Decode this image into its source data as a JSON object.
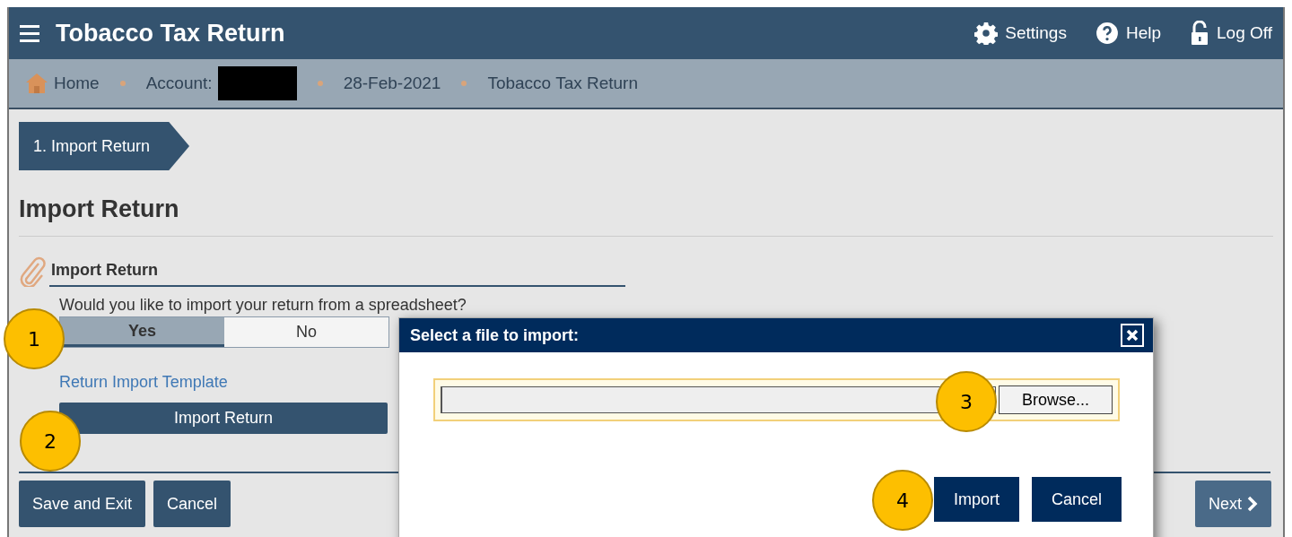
{
  "header": {
    "title": "Tobacco Tax Return",
    "actions": [
      {
        "label": "Settings",
        "kind": "gear"
      },
      {
        "label": "Help",
        "kind": "help"
      },
      {
        "label": "Log Off",
        "kind": "lock"
      }
    ]
  },
  "breadcrumb": [
    {
      "label": "Home",
      "kind": "home"
    },
    {
      "label": "Account:",
      "kind": "redacted"
    },
    {
      "label": "28-Feb-2021",
      "kind": "text"
    },
    {
      "label": "Tobacco Tax Return",
      "kind": "text"
    }
  ],
  "steps": [
    {
      "label": "1. Import Return",
      "selected": true
    }
  ],
  "page_title": "Import Return",
  "section": {
    "title": "Import Return",
    "question": "Would you like to import your return from a spreadsheet?",
    "options": [
      {
        "label": "Yes",
        "selected": true
      },
      {
        "label": "No",
        "selected": false
      }
    ],
    "link": "Return Import Template",
    "action": "Import Return"
  },
  "footer": {
    "buttons": [
      "Save and Exit",
      "Cancel"
    ],
    "next": "Next"
  },
  "dialog": {
    "title": "Select a file to import:",
    "browse": "Browse...",
    "buttons": [
      "Import",
      "Cancel"
    ]
  },
  "annotations": [
    "1",
    "2",
    "3",
    "4"
  ]
}
